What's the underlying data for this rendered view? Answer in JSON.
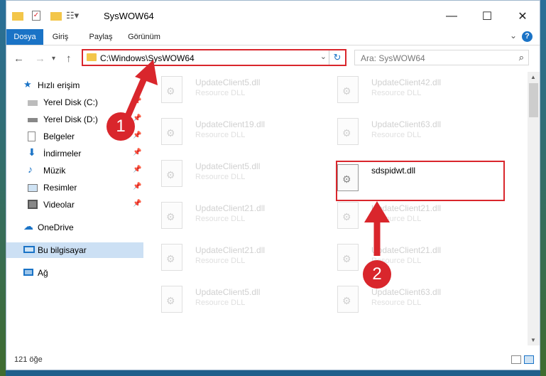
{
  "window": {
    "title": "SysWOW64"
  },
  "ribbon": {
    "tabs": [
      "Dosya",
      "Giriş",
      "Paylaş",
      "Görünüm"
    ],
    "help": "?"
  },
  "address": {
    "path": "C:\\Windows\\SysWOW64"
  },
  "search": {
    "placeholder": "Ara: SysWOW64"
  },
  "sidebar": {
    "items": [
      {
        "label": "Hızlı erişim"
      },
      {
        "label": "Yerel Disk (C:)"
      },
      {
        "label": "Yerel Disk (D:)"
      },
      {
        "label": "Belgeler"
      },
      {
        "label": "İndirmeler"
      },
      {
        "label": "Müzik"
      },
      {
        "label": "Resimler"
      },
      {
        "label": "Videolar"
      },
      {
        "label": "OneDrive"
      },
      {
        "label": "Bu bilgisayar"
      },
      {
        "label": "Ağ"
      }
    ]
  },
  "files": {
    "left": [
      {
        "name": "UpdateClient5.dll",
        "type": "Resource DLL"
      },
      {
        "name": "UpdateClient19.dll",
        "type": "Resource DLL"
      },
      {
        "name": "UpdateClient5.dll",
        "type": "Resource DLL"
      },
      {
        "name": "UpdateClient21.dll",
        "type": "Resource DLL"
      },
      {
        "name": "UpdateClient21.dll",
        "type": "Resource DLL"
      },
      {
        "name": "UpdateClient5.dll",
        "type": "Resource DLL"
      }
    ],
    "right": [
      {
        "name": "UpdateClient42.dll",
        "type": "Resource DLL"
      },
      {
        "name": "UpdateClient63.dll",
        "type": "Resource DLL"
      },
      {
        "name": "sdspidwt.dll",
        "type": ""
      },
      {
        "name": "UpdateClient21.dll",
        "type": "Resource DLL"
      },
      {
        "name": "UpdateClient21.dll",
        "type": "Resource DLL"
      },
      {
        "name": "UpdateClient63.dll",
        "type": "Resource DLL"
      }
    ]
  },
  "status": {
    "count": "121 öğe"
  },
  "annotations": {
    "step1": "1",
    "step2": "2"
  },
  "colors": {
    "accent": "#1a73c6",
    "highlight": "#d9262c"
  }
}
